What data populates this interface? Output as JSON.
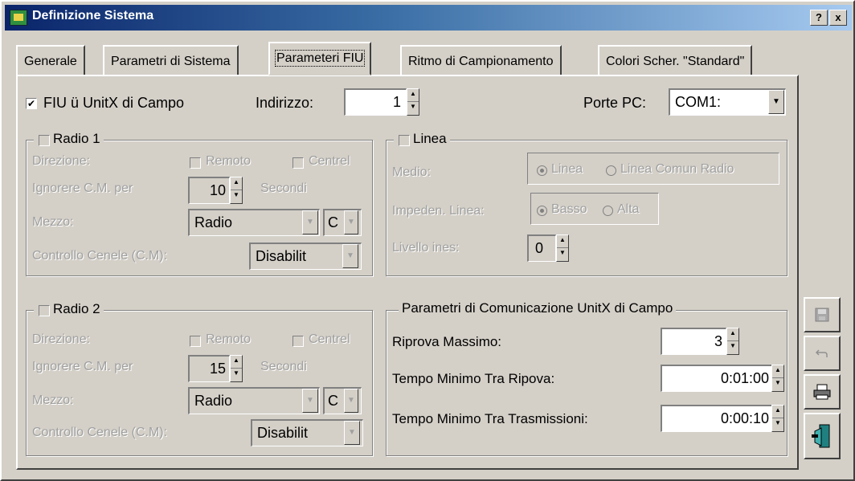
{
  "window": {
    "title": "Definizione Sistema",
    "help_btn": "?",
    "close_btn": "x"
  },
  "tabs": [
    {
      "label": "Generale"
    },
    {
      "label": "Parametri di Sistema"
    },
    {
      "label": "Parameteri FIU"
    },
    {
      "label": "Ritmo di Campionamento"
    },
    {
      "label": "Colori Scher. \"Standard\""
    }
  ],
  "fiu": {
    "checkbox_label": "FIU ü UnitX di Campo",
    "checked": true,
    "address_label": "Indirizzo:",
    "address_value": "1",
    "port_label": "Porte PC:",
    "port_value": "COM1:"
  },
  "radio1": {
    "title": "Radio 1",
    "direction_label": "Direzione:",
    "remote_label": "Remoto",
    "central_label": "Centrel",
    "ignore_label": "Ignorere C.M. per",
    "ignore_value": "10",
    "seconds_label": "Secondi",
    "medium_label": "Mezzo:",
    "medium_value": "Radio",
    "channel_value": "C",
    "control_label": "Controllo Cenele (C.M):",
    "control_value": "Disabilit"
  },
  "radio2": {
    "title": "Radio 2",
    "direction_label": "Direzione:",
    "remote_label": "Remoto",
    "central_label": "Centrel",
    "ignore_label": "Ignorere C.M. per",
    "ignore_value": "15",
    "seconds_label": "Secondi",
    "medium_label": "Mezzo:",
    "medium_value": "Radio",
    "channel_value": "C",
    "control_label": "Controllo Cenele (C.M):",
    "control_value": "Disabilit"
  },
  "linea": {
    "title": "Linea",
    "medio_label": "Medio:",
    "opt_linea": "Linea",
    "opt_comm": "Linea Comun Radio",
    "imped_label": "Impeden. Linea:",
    "opt_basso": "Basso",
    "opt_alta": "Alta",
    "level_label": "Livello ines:",
    "level_value": "0"
  },
  "comm": {
    "title": "Parametri di Comunicazione UnitX di Campo",
    "retry_label": "Riprova Massimo:",
    "retry_value": "3",
    "min_retry_label": "Tempo Minimo Tra Ripova:",
    "min_retry_value": "0:01:00",
    "min_tx_label": "Tempo Minimo Tra Trasmissioni:",
    "min_tx_value": "0:00:10"
  },
  "side_buttons": [
    "save-icon",
    "undo-icon",
    "print-icon",
    "exit-icon"
  ]
}
